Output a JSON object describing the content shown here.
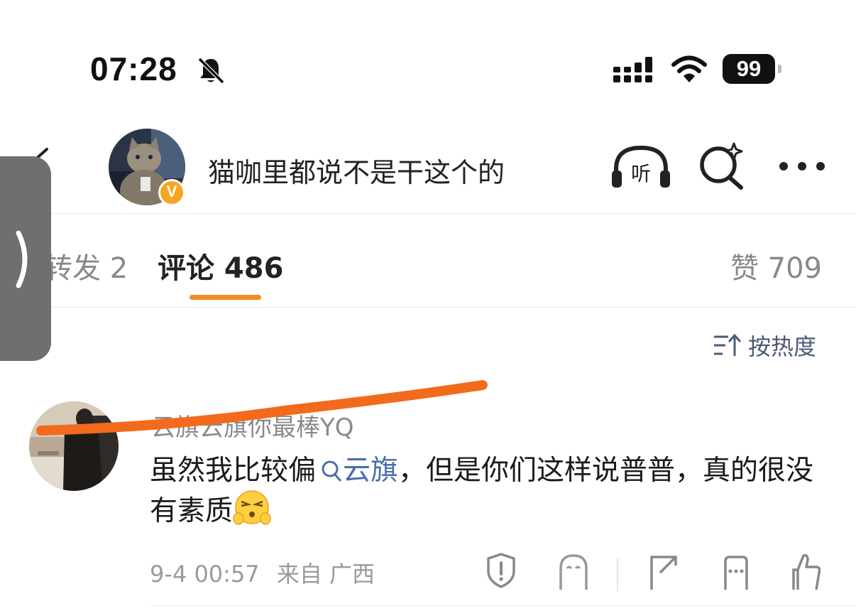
{
  "status_bar": {
    "time": "07:28",
    "battery": "99",
    "icons": [
      "bell-slash-icon",
      "cellular-signal-icon",
      "wifi-icon",
      "battery-icon"
    ]
  },
  "header": {
    "title": "猫咖里都说不是干这个的",
    "badge": "V",
    "listen_label": "听",
    "icons": [
      "back-chevron-icon",
      "headphones-icon",
      "search-sparkle-icon",
      "more-dots-icon"
    ]
  },
  "tabs": {
    "repost": "转发 2",
    "comments": "评论 486",
    "likes": "赞 709",
    "active": "comments"
  },
  "sort": {
    "label": "按热度"
  },
  "comment": {
    "username": "云旗云旗你最棒YQ",
    "text_before": "虽然我比较偏",
    "link_text": "云旗",
    "text_after": "，但是你们这样说普普，真的很没有素质",
    "date": "9-4 00:57",
    "location": "来自 广西",
    "actions": [
      "report-shield-icon",
      "ghost-icon",
      "share-icon",
      "reply-icon",
      "like-thumb-icon"
    ]
  },
  "colors": {
    "accent": "#f08a24",
    "link": "#4a6ea8",
    "annotation": "#f26a1b",
    "side_handle": "#6f6f6f"
  }
}
